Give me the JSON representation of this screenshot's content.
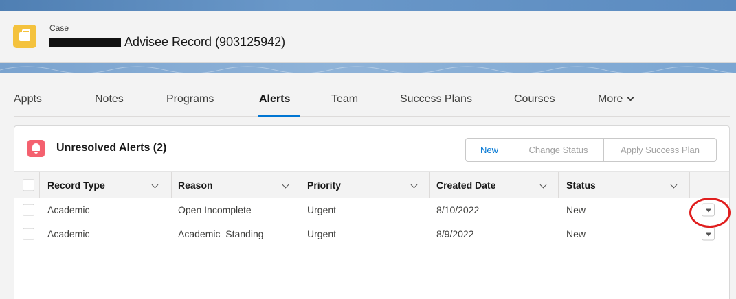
{
  "header": {
    "object_label": "Case",
    "record_title": "Advisee Record (903125942)"
  },
  "tabs": [
    {
      "label": "Appts"
    },
    {
      "label": "Notes"
    },
    {
      "label": "Programs"
    },
    {
      "label": "Alerts",
      "active": true
    },
    {
      "label": "Team"
    },
    {
      "label": "Success Plans"
    },
    {
      "label": "Courses"
    },
    {
      "label": "More"
    }
  ],
  "alerts_card": {
    "title": "Unresolved Alerts (2)",
    "buttons": {
      "new": "New",
      "change_status": "Change Status",
      "apply_success_plan": "Apply Success Plan"
    },
    "columns": [
      "Record Type",
      "Reason",
      "Priority",
      "Created Date",
      "Status"
    ],
    "rows": [
      [
        "Academic",
        "Open Incomplete",
        "Urgent",
        "8/10/2022",
        "New"
      ],
      [
        "Academic",
        "Academic_Standing",
        "Urgent",
        "8/9/2022",
        "New"
      ]
    ]
  },
  "colors": {
    "accent": "#0176d3",
    "case_icon": "#f4c23d",
    "alert_icon": "#f4616f",
    "annotation": "#e01e1e"
  },
  "icons": {
    "case": "case-briefcase-icon",
    "alert": "bell-icon",
    "more": "chevron-down-icon",
    "row_action": "row-action-dropdown-icon"
  }
}
